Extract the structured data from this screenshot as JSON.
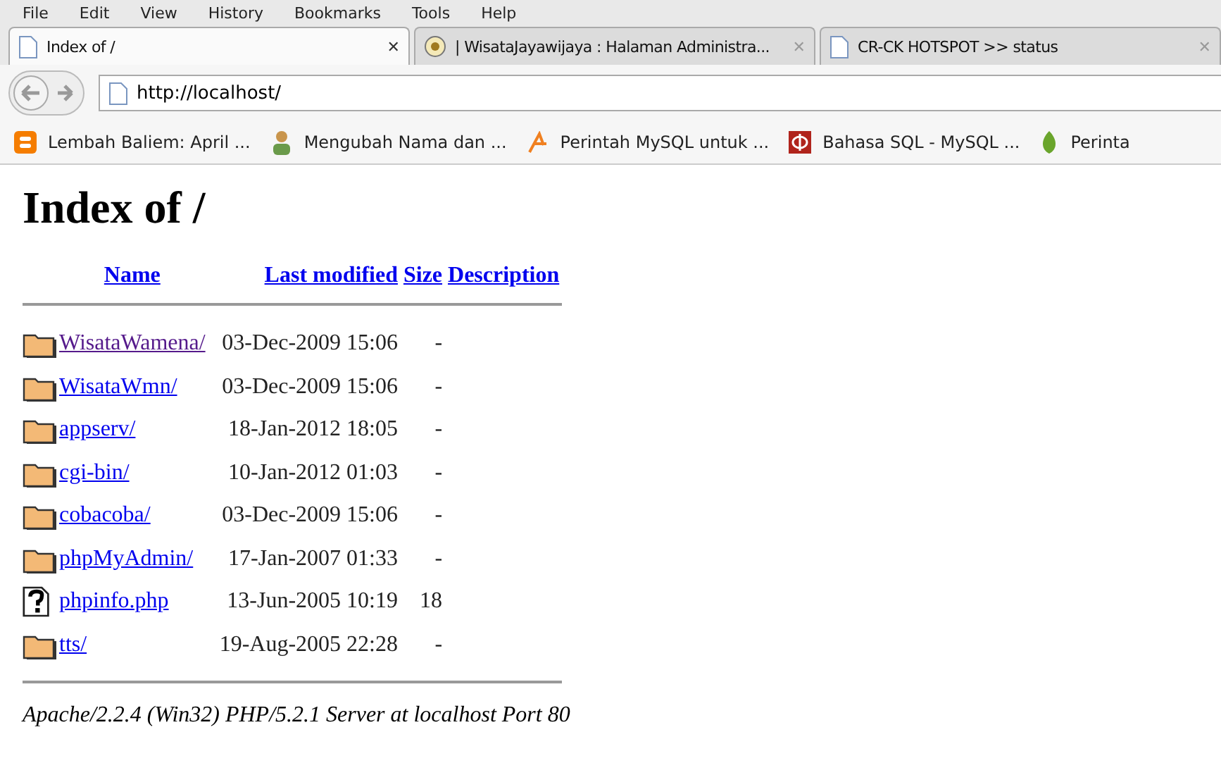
{
  "menu": [
    "File",
    "Edit",
    "View",
    "History",
    "Bookmarks",
    "Tools",
    "Help"
  ],
  "tabs": [
    {
      "title": "Index of /",
      "selected": true,
      "kind": "page",
      "close": "✕"
    },
    {
      "title": "| WisataJayawijaya : Halaman Administra...",
      "selected": false,
      "kind": "logo",
      "close": "✕"
    },
    {
      "title": "CR-CK HOTSPOT >> status",
      "selected": false,
      "kind": "page",
      "close": "✕"
    }
  ],
  "address": {
    "value": "http://localhost/"
  },
  "bookmarks": [
    {
      "label": "Lembah Baliem: April ...",
      "kind": "blogger"
    },
    {
      "label": "Mengubah Nama dan ...",
      "kind": "person"
    },
    {
      "label": "Perintah MySQL untuk ...",
      "kind": "arrow"
    },
    {
      "label": "Bahasa SQL - MySQL ...",
      "kind": "phi"
    },
    {
      "label": "Perinta",
      "kind": "leaf"
    }
  ],
  "heading": "Index of /",
  "columns": [
    "Name",
    "Last modified",
    "Size",
    "Description"
  ],
  "rows": [
    {
      "kind": "folder",
      "name": "WisataWamena/",
      "visited": true,
      "modified": "03-Dec-2009 15:06",
      "size": "-"
    },
    {
      "kind": "folder",
      "name": "WisataWmn/",
      "visited": false,
      "modified": "03-Dec-2009 15:06",
      "size": "-"
    },
    {
      "kind": "folder",
      "name": "appserv/",
      "visited": false,
      "modified": "18-Jan-2012 18:05",
      "size": "-"
    },
    {
      "kind": "folder",
      "name": "cgi-bin/",
      "visited": false,
      "modified": "10-Jan-2012 01:03",
      "size": "-"
    },
    {
      "kind": "folder",
      "name": "cobacoba/",
      "visited": false,
      "modified": "03-Dec-2009 15:06",
      "size": "-"
    },
    {
      "kind": "folder",
      "name": "phpMyAdmin/",
      "visited": false,
      "modified": "17-Jan-2007 01:33",
      "size": "-"
    },
    {
      "kind": "unknown",
      "name": "phpinfo.php",
      "visited": false,
      "modified": "13-Jun-2005 10:19",
      "size": "18"
    },
    {
      "kind": "folder",
      "name": "tts/",
      "visited": false,
      "modified": "19-Aug-2005 22:28",
      "size": "-"
    }
  ],
  "footer": "Apache/2.2.4 (Win32) PHP/5.2.1 Server at localhost Port 80"
}
